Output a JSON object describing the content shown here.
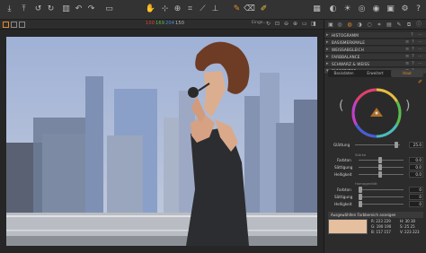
{
  "colors": {
    "accent": "#e58a2a",
    "swatch": "#e5bf9e",
    "red": "#e0443a",
    "green": "#5fbf4a",
    "blue": "#4a8ee0"
  },
  "toolbar": {
    "icons": [
      "import-icon",
      "export-icon",
      "rotate-left-icon",
      "rotate-right-icon",
      "delete-icon",
      "undo-icon",
      "redo-icon",
      "copy-icon",
      "pan-icon",
      "select-icon",
      "crop-icon",
      "straighten-icon",
      "keystone-icon",
      "spot-icon",
      "eyedropper-icon",
      "brush-icon",
      "grid-icon",
      "exposure-icon",
      "proof-icon",
      "help-icon"
    ]
  },
  "readout": {
    "r": "100",
    "g": "169",
    "b": "204",
    "l": "150"
  },
  "viewer_label": "Einge...",
  "panel": {
    "sections": [
      {
        "label": "HISTOGRAMM"
      },
      {
        "label": "BASISMERKMALE"
      },
      {
        "label": "WEISSABGLEICH"
      },
      {
        "label": "FARBBALANCE"
      },
      {
        "label": "SCHWARZ & WEISS"
      },
      {
        "label": "FARBEDITOR"
      }
    ],
    "subtabs": [
      "Basisdaten",
      "Erweitert",
      "Haut"
    ],
    "glaettung_label": "Glättung",
    "glaettung_value": "25.0",
    "group1": "Stärke",
    "group2": "Homogenität",
    "sliders1": [
      {
        "label": "Farbton",
        "value": "0.0"
      },
      {
        "label": "Sättigung",
        "value": "0.0"
      },
      {
        "label": "Helligkeit",
        "value": "0.0"
      }
    ],
    "sliders2": [
      {
        "label": "Farbton",
        "value": "0"
      },
      {
        "label": "Sättigung",
        "value": "0"
      },
      {
        "label": "Helligkeit",
        "value": "0"
      }
    ],
    "selected_label": "Ausgewählten Farbbereich anzeigen",
    "rgb_rows": [
      {
        "ch": "R:",
        "v1": "223",
        "v2": "229",
        "ch2": "H:",
        "v3": "30",
        "v4": "30"
      },
      {
        "ch": "G:",
        "v1": "190",
        "v2": "190",
        "ch2": "S:",
        "v3": "25",
        "v4": "25"
      },
      {
        "ch": "B:",
        "v1": "157",
        "v2": "157",
        "ch2": "V:",
        "v3": "223",
        "v4": "223"
      }
    ]
  }
}
